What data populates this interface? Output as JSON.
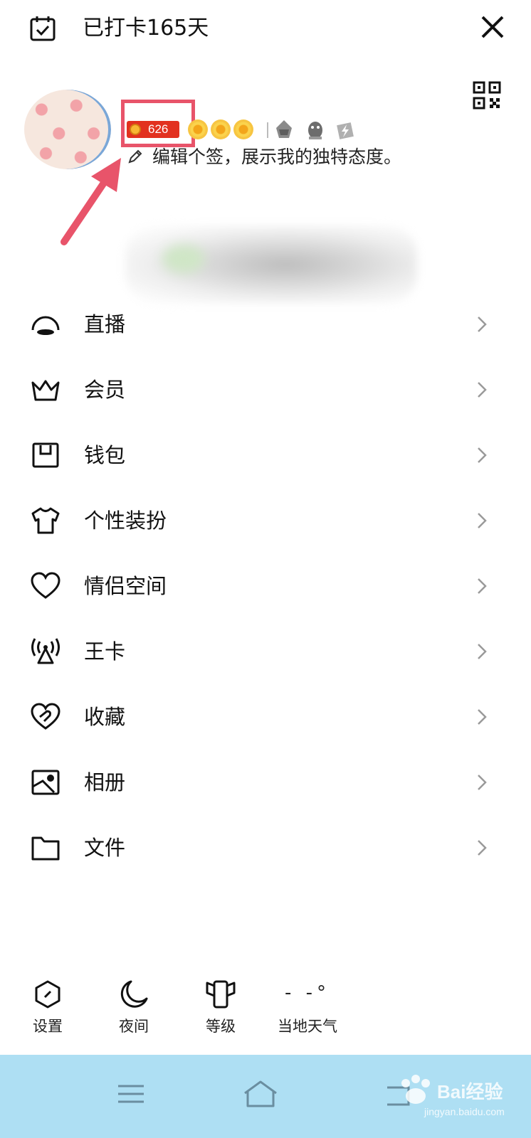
{
  "header": {
    "checkin_text": "已打卡165天"
  },
  "profile": {
    "level_value": "626",
    "signature": "编辑个签，展示我的独特态度。",
    "highlight_color": "#e8546a"
  },
  "menu": {
    "items": [
      {
        "label": "直播",
        "icon": "live-icon"
      },
      {
        "label": "会员",
        "icon": "crown-icon"
      },
      {
        "label": "钱包",
        "icon": "wallet-icon"
      },
      {
        "label": "个性装扮",
        "icon": "tshirt-icon"
      },
      {
        "label": "情侣空间",
        "icon": "heart-icon"
      },
      {
        "label": "王卡",
        "icon": "signal-tower-icon"
      },
      {
        "label": "收藏",
        "icon": "favorite-heart-icon"
      },
      {
        "label": "相册",
        "icon": "photo-album-icon"
      },
      {
        "label": "文件",
        "icon": "folder-icon"
      }
    ]
  },
  "quick_actions": {
    "settings": "设置",
    "night": "夜间",
    "level": "等级",
    "weather_value": "- -°",
    "weather": "当地天气"
  },
  "watermark": {
    "brand": "Bai经验",
    "url": "jingyan.baidu.com"
  },
  "colors": {
    "navbar": "#aedff3",
    "badge_red": "#e2311f"
  }
}
